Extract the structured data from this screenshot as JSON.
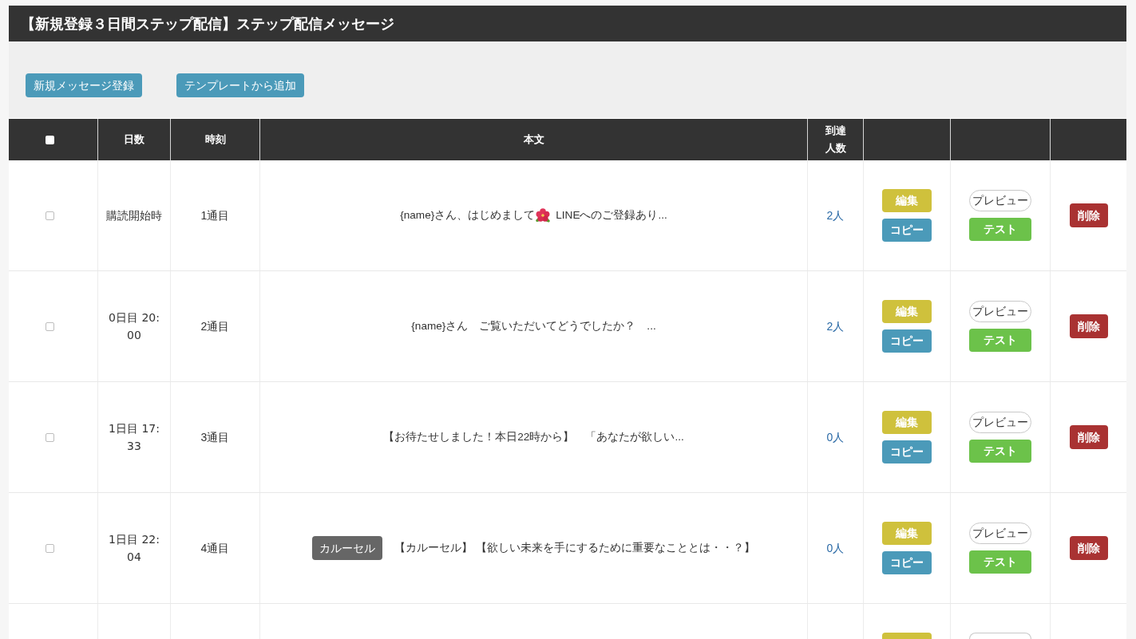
{
  "page_title": "【新規登録３日間ステップ配信】ステップ配信メッセージ",
  "toolbar": {
    "buttons": [
      {
        "label": "新規メッセージ登録"
      },
      {
        "label": "テンプレートから追加"
      }
    ]
  },
  "table": {
    "select_all_checked": false,
    "columns": [
      {
        "label": "日数"
      },
      {
        "label": "時刻"
      },
      {
        "label": "本文"
      },
      {
        "label": "到達人数"
      }
    ],
    "rows": [
      {
        "checked": false,
        "day": "購読開始時",
        "number": "1通目",
        "message": [
          {
            "kind": "text",
            "text": "{name}さん、はじめまして"
          },
          {
            "kind": "emoji"
          },
          {
            "kind": "text",
            "text": "LINEへのご登録あり..."
          }
        ],
        "reach": "2人",
        "buttons": [
          {
            "kind": "edit",
            "label": "編集"
          },
          {
            "kind": "copy",
            "label": "コピー"
          },
          {
            "kind": "preview",
            "label": "プレビュー"
          },
          {
            "kind": "test",
            "label": "テスト"
          },
          {
            "kind": "delete",
            "label": "削除"
          }
        ]
      },
      {
        "checked": false,
        "day": "0日目 20:00",
        "number": "2通目",
        "message": [
          {
            "kind": "text",
            "text": "{name}さん　ご覧いただいてどうでしたか？　..."
          }
        ],
        "reach": "2人",
        "buttons": [
          {
            "kind": "edit",
            "label": "編集"
          },
          {
            "kind": "copy",
            "label": "コピー"
          },
          {
            "kind": "preview",
            "label": "プレビュー"
          },
          {
            "kind": "test",
            "label": "テスト"
          },
          {
            "kind": "delete",
            "label": "削除"
          }
        ]
      },
      {
        "checked": false,
        "day": "1日目 17:33",
        "number": "3通目",
        "message": [
          {
            "kind": "text",
            "text": "【お待たせしました！本日22時から】　「あなたが欲しい..."
          }
        ],
        "reach": "0人",
        "buttons": [
          {
            "kind": "edit",
            "label": "編集"
          },
          {
            "kind": "copy",
            "label": "コピー"
          },
          {
            "kind": "preview",
            "label": "プレビュー"
          },
          {
            "kind": "test",
            "label": "テスト"
          },
          {
            "kind": "delete",
            "label": "削除"
          }
        ]
      },
      {
        "checked": false,
        "day": "1日目 22:04",
        "number": "4通目",
        "message": [
          {
            "kind": "tag",
            "text": "カルーセル"
          },
          {
            "kind": "text",
            "text": "【カルーセル】 【欲しい未来を手にするために重要なこととは・・？】"
          }
        ],
        "reach": "0人",
        "buttons": [
          {
            "kind": "edit",
            "label": "編集"
          },
          {
            "kind": "copy",
            "label": "コピー"
          },
          {
            "kind": "preview",
            "label": "プレビュー"
          },
          {
            "kind": "test",
            "label": "テスト"
          },
          {
            "kind": "delete",
            "label": "削除"
          }
        ]
      }
    ],
    "cut_off_row": {
      "buttons": [
        {
          "kind": "edit"
        },
        {
          "kind": "preview"
        }
      ]
    }
  }
}
